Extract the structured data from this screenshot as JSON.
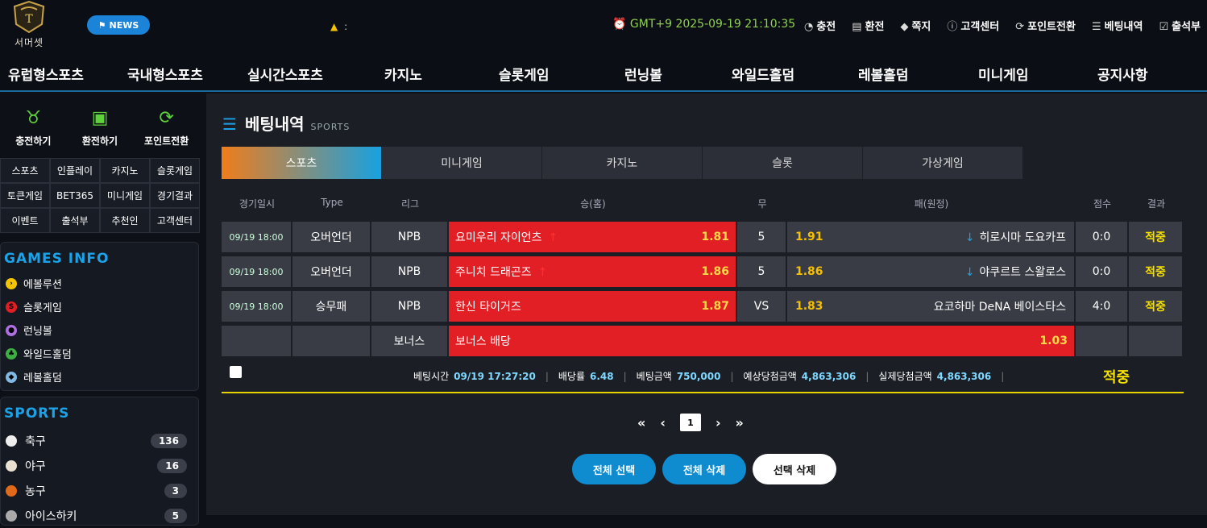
{
  "header": {
    "logo_text": "서머셋",
    "news_label": "NEWS",
    "marquee": ":",
    "clock": "GMT+9 2025-09-19 21:10:35",
    "links": [
      {
        "icon": "piggy-icon",
        "glyph": "◔",
        "label": "충전"
      },
      {
        "icon": "wallet-icon",
        "glyph": "▤",
        "label": "환전"
      },
      {
        "icon": "tag-icon",
        "glyph": "◆",
        "label": "쪽지"
      },
      {
        "icon": "info-icon",
        "glyph": "ⓘ",
        "label": "고객센터"
      },
      {
        "icon": "refresh-icon",
        "glyph": "⟳",
        "label": "포인트전환"
      },
      {
        "icon": "list-icon",
        "glyph": "☰",
        "label": "베팅내역"
      },
      {
        "icon": "calendar-icon",
        "glyph": "☑",
        "label": "출석부"
      }
    ]
  },
  "nav": [
    "유럽형스포츠",
    "국내형스포츠",
    "실시간스포츠",
    "카지노",
    "슬롯게임",
    "런닝볼",
    "와일드홀덤",
    "레볼홀덤",
    "미니게임",
    "공지사항"
  ],
  "sidebar": {
    "quick": [
      {
        "icon": "piggy-icon",
        "glyph": "♉",
        "label": "충전하기"
      },
      {
        "icon": "cash-icon",
        "glyph": "▣",
        "label": "환전하기"
      },
      {
        "icon": "refresh-icon",
        "glyph": "⟳",
        "label": "포인트전환"
      }
    ],
    "grid": [
      "스포츠",
      "인플레이",
      "카지노",
      "슬롯게임",
      "토큰게임",
      "BET365",
      "미니게임",
      "경기결과",
      "이벤트",
      "출석부",
      "추천인",
      "고객센터"
    ],
    "games_title": "GAMES INFO",
    "games": [
      {
        "label": "에볼루션",
        "color": "#f5c400",
        "glyph": "›"
      },
      {
        "label": "슬롯게임",
        "color": "#e31f26",
        "glyph": "S"
      },
      {
        "label": "런닝볼",
        "color": "#b06fe0",
        "glyph": "●"
      },
      {
        "label": "와일드홀덤",
        "color": "#3cb043",
        "glyph": "♣"
      },
      {
        "label": "레볼홀덤",
        "color": "#7fb8e0",
        "glyph": "◆"
      }
    ],
    "sports_title": "SPORTS",
    "sports": [
      {
        "label": "축구",
        "count": "136",
        "color": "#eeeeee"
      },
      {
        "label": "야구",
        "count": "16",
        "color": "#e8e0d0"
      },
      {
        "label": "농구",
        "count": "3",
        "color": "#e06a1a"
      },
      {
        "label": "아이스하키",
        "count": "5",
        "color": "#aaaaaa"
      }
    ]
  },
  "main": {
    "title": "베팅내역",
    "subtitle": "SPORTS",
    "tabs": [
      "스포츠",
      "미니게임",
      "카지노",
      "슬롯",
      "가상게임"
    ],
    "columns": [
      "경기일시",
      "Type",
      "리그",
      "승(홈)",
      "무",
      "패(원정)",
      "점수",
      "결과"
    ],
    "rows": [
      {
        "date": "09/19 18:00",
        "type": "오버언더",
        "league": "NPB",
        "home": "요미우리 자이언츠",
        "home_odds": "1.81",
        "home_arrow": "↑",
        "draw": "5",
        "away_odds": "1.91",
        "away_arrow": "↓",
        "away": "히로시마 도요카프",
        "score": "0:0",
        "result": "적중"
      },
      {
        "date": "09/19 18:00",
        "type": "오버언더",
        "league": "NPB",
        "home": "주니치 드래곤즈",
        "home_odds": "1.86",
        "home_arrow": "↑",
        "draw": "5",
        "away_odds": "1.86",
        "away_arrow": "↓",
        "away": "야쿠르트 스왈로스",
        "score": "0:0",
        "result": "적중"
      },
      {
        "date": "09/19 18:00",
        "type": "승무패",
        "league": "NPB",
        "home": "한신 타이거즈",
        "home_odds": "1.87",
        "home_arrow": "",
        "draw": "VS",
        "away_odds": "1.83",
        "away_arrow": "",
        "away": "요코하마 DeNA 베이스타스",
        "score": "4:0",
        "result": "적중"
      }
    ],
    "bonus": {
      "league": "보너스",
      "label": "보너스 배당",
      "odds": "1.03"
    },
    "summary": {
      "bet_time_label": "베팅시간",
      "bet_time": "09/19 17:27:20",
      "odds_label": "배당률",
      "odds": "6.48",
      "amount_label": "베팅금액",
      "amount": "750,000",
      "expected_label": "예상당첨금액",
      "expected": "4,863,306",
      "actual_label": "실제당첨금액",
      "actual": "4,863,306",
      "final": "적중"
    },
    "pager": {
      "first": "«",
      "prev": "‹",
      "page": "1",
      "next": "›",
      "last": "»"
    },
    "buttons": {
      "select_all": "전체 선택",
      "delete_all": "전체 삭제",
      "delete_selected": "선택 삭제"
    }
  }
}
